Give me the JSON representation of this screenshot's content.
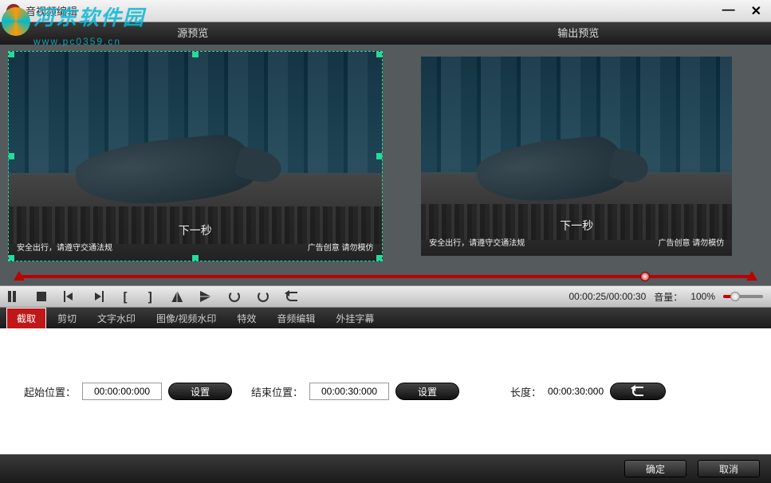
{
  "titlebar": {
    "title": "音视频编辑"
  },
  "watermark": {
    "text": "河东软件园",
    "url": "www.pc0359.cn"
  },
  "previews": {
    "source_label": "源预览",
    "output_label": "输出预览"
  },
  "video_overlay": {
    "center": "下一秒",
    "left": "安全出行，请遵守交通法规",
    "right": "广告创意 请勿模仿"
  },
  "controls": {
    "time_current": "00:00:25",
    "time_total": "00:00:30",
    "volume_label": "音量：",
    "volume_value": "100%"
  },
  "tabs": [
    {
      "label": "截取",
      "active": true
    },
    {
      "label": "剪切",
      "active": false
    },
    {
      "label": "文字水印",
      "active": false
    },
    {
      "label": "图像/视频水印",
      "active": false
    },
    {
      "label": "特效",
      "active": false
    },
    {
      "label": "音频编辑",
      "active": false
    },
    {
      "label": "外挂字幕",
      "active": false
    }
  ],
  "clip": {
    "start_label": "起始位置：",
    "start_value": "00:00:00:000",
    "start_set": "设置",
    "end_label": "结束位置：",
    "end_value": "00:00:30:000",
    "end_set": "设置",
    "length_label": "长度：",
    "length_value": "00:00:30:000"
  },
  "footer": {
    "ok": "确定",
    "cancel": "取消"
  }
}
